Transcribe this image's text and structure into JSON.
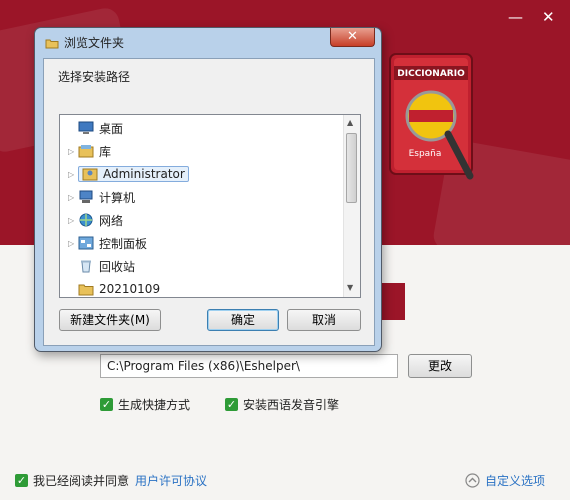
{
  "window": {
    "minimize_glyph": "—",
    "close_glyph": "✕"
  },
  "banner": {
    "book_title": "DICCIONARIO",
    "book_subtitle": "España"
  },
  "install": {
    "path_value": "C:\\Program Files (x86)\\Eshelper\\",
    "change_button": "更改",
    "options": [
      {
        "label": "生成快捷方式",
        "checked": true
      },
      {
        "label": "安装西语发音引擎",
        "checked": true
      }
    ]
  },
  "footer": {
    "agree_label": "我已经阅读并同意",
    "license_link": "用户许可协议",
    "custom_options": "自定义选项"
  },
  "dialog": {
    "title": "浏览文件夹",
    "close_glyph": "✕",
    "prompt": "选择安装路径",
    "tree": [
      {
        "label": "桌面",
        "icon": "desktop-icon",
        "expandable": false,
        "selected": false
      },
      {
        "label": "库",
        "icon": "library-icon",
        "expandable": true,
        "selected": false
      },
      {
        "label": "Administrator",
        "icon": "user-folder-icon",
        "expandable": true,
        "selected": true
      },
      {
        "label": "计算机",
        "icon": "computer-icon",
        "expandable": true,
        "selected": false
      },
      {
        "label": "网络",
        "icon": "network-icon",
        "expandable": true,
        "selected": false
      },
      {
        "label": "控制面板",
        "icon": "control-panel-icon",
        "expandable": true,
        "selected": false
      },
      {
        "label": "回收站",
        "icon": "recycle-bin-icon",
        "expandable": false,
        "selected": false
      },
      {
        "label": "20210109",
        "icon": "folder-icon",
        "expandable": false,
        "selected": false
      }
    ],
    "new_folder_button": "新建文件夹(M)",
    "ok_button": "确定",
    "cancel_button": "取消"
  },
  "colors": {
    "banner": "#9b1528",
    "check": "#2e9b37",
    "link": "#2a72c4"
  }
}
